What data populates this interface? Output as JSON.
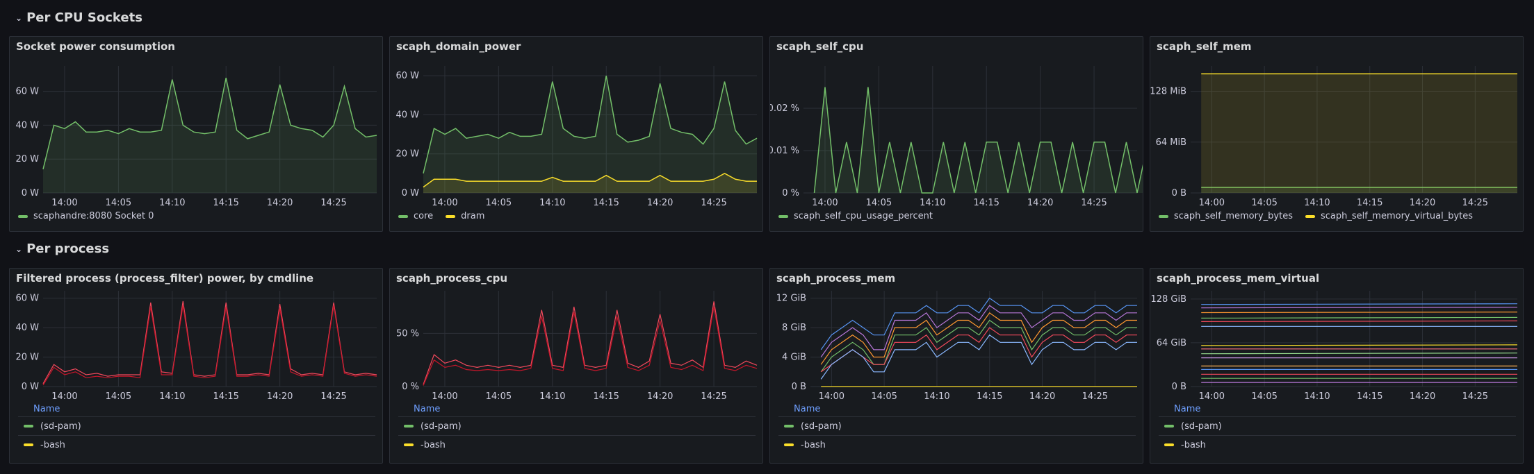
{
  "rows": [
    {
      "title": "Per CPU Sockets"
    },
    {
      "title": "Per process"
    }
  ],
  "colors": {
    "green": "#73bf69",
    "yellow": "#fade2a",
    "red": "#f2495c",
    "bg": "#181b1f",
    "grid": "#2c3038"
  },
  "time_labels": [
    "14:00",
    "14:05",
    "14:10",
    "14:15",
    "14:20",
    "14:25"
  ],
  "panels": [
    {
      "title": "Socket power consumption",
      "legend": [
        {
          "label": "scaphandre:8080 Socket 0",
          "color": "#73bf69"
        }
      ]
    },
    {
      "title": "scaph_domain_power",
      "legend": [
        {
          "label": "core",
          "color": "#73bf69"
        },
        {
          "label": "dram",
          "color": "#fade2a"
        }
      ]
    },
    {
      "title": "scaph_self_cpu",
      "legend": [
        {
          "label": "scaph_self_cpu_usage_percent",
          "color": "#73bf69"
        }
      ]
    },
    {
      "title": "scaph_self_mem",
      "legend": [
        {
          "label": "scaph_self_memory_bytes",
          "color": "#73bf69"
        },
        {
          "label": "scaph_self_memory_virtual_bytes",
          "color": "#fade2a"
        }
      ]
    },
    {
      "title": "Filtered process (process_filter) power, by cmdline",
      "table_header": "Name",
      "legend": [
        {
          "label": "(sd-pam)",
          "color": "#73bf69"
        },
        {
          "label": "-bash",
          "color": "#fade2a"
        }
      ]
    },
    {
      "title": "scaph_process_cpu",
      "table_header": "Name",
      "legend": [
        {
          "label": "(sd-pam)",
          "color": "#73bf69"
        },
        {
          "label": "-bash",
          "color": "#fade2a"
        }
      ]
    },
    {
      "title": "scaph_process_mem",
      "table_header": "Name",
      "legend": [
        {
          "label": "(sd-pam)",
          "color": "#73bf69"
        },
        {
          "label": "-bash",
          "color": "#fade2a"
        }
      ]
    },
    {
      "title": "scaph_process_mem_virtual",
      "table_header": "Name",
      "legend": [
        {
          "label": "(sd-pam)",
          "color": "#73bf69"
        },
        {
          "label": "-bash",
          "color": "#fade2a"
        }
      ]
    }
  ],
  "chart_data": [
    {
      "type": "area",
      "panel": 0,
      "y_ticks": [
        "0 W",
        "20 W",
        "40 W",
        "60 W"
      ],
      "ylim": [
        0,
        75
      ],
      "x": [
        "13:58",
        "13:59",
        "14:00",
        "14:01",
        "14:02",
        "14:03",
        "14:04",
        "14:05",
        "14:06",
        "14:07",
        "14:08",
        "14:09",
        "14:10",
        "14:11",
        "14:12",
        "14:13",
        "14:14",
        "14:15",
        "14:16",
        "14:17",
        "14:18",
        "14:19",
        "14:20",
        "14:21",
        "14:22",
        "14:23",
        "14:24",
        "14:25",
        "14:26",
        "14:27",
        "14:28",
        "14:29"
      ],
      "series": [
        {
          "name": "scaphandre:8080 Socket 0",
          "color": "#73bf69",
          "values": [
            14,
            40,
            38,
            42,
            36,
            36,
            37,
            35,
            38,
            36,
            36,
            37,
            67,
            40,
            36,
            35,
            36,
            68,
            37,
            32,
            34,
            36,
            64,
            40,
            38,
            37,
            33,
            40,
            63,
            38,
            33,
            34
          ]
        }
      ]
    },
    {
      "type": "area",
      "panel": 1,
      "y_ticks": [
        "0 W",
        "20 W",
        "40 W",
        "60 W"
      ],
      "ylim": [
        0,
        65
      ],
      "x": [
        "13:58",
        "13:59",
        "14:00",
        "14:01",
        "14:02",
        "14:03",
        "14:04",
        "14:05",
        "14:06",
        "14:07",
        "14:08",
        "14:09",
        "14:10",
        "14:11",
        "14:12",
        "14:13",
        "14:14",
        "14:15",
        "14:16",
        "14:17",
        "14:18",
        "14:19",
        "14:20",
        "14:21",
        "14:22",
        "14:23",
        "14:24",
        "14:25",
        "14:26",
        "14:27",
        "14:28",
        "14:29"
      ],
      "series": [
        {
          "name": "core",
          "color": "#73bf69",
          "values": [
            10,
            33,
            30,
            33,
            28,
            29,
            30,
            28,
            31,
            29,
            29,
            30,
            57,
            33,
            29,
            28,
            29,
            60,
            30,
            26,
            27,
            29,
            56,
            33,
            31,
            30,
            25,
            33,
            57,
            32,
            25,
            28
          ]
        },
        {
          "name": "dram",
          "color": "#fade2a",
          "values": [
            3,
            7,
            7,
            7,
            6,
            6,
            6,
            6,
            6,
            6,
            6,
            6,
            8,
            6,
            6,
            6,
            6,
            9,
            6,
            6,
            6,
            6,
            9,
            6,
            6,
            6,
            6,
            7,
            10,
            7,
            6,
            6
          ]
        }
      ]
    },
    {
      "type": "area",
      "panel": 2,
      "y_ticks": [
        "0 %",
        "0.01 %",
        "0.02 %"
      ],
      "ylim": [
        0,
        0.03
      ],
      "x": [
        "13:59",
        "14:00",
        "14:01",
        "14:02",
        "14:03",
        "14:04",
        "14:05",
        "14:06",
        "14:07",
        "14:08",
        "14:09",
        "14:10",
        "14:11",
        "14:12",
        "14:13",
        "14:14",
        "14:15",
        "14:16",
        "14:17",
        "14:18",
        "14:19",
        "14:20",
        "14:21",
        "14:22",
        "14:23",
        "14:24",
        "14:25",
        "14:26",
        "14:27",
        "14:28",
        "14:29",
        "14:30"
      ],
      "series": [
        {
          "name": "scaph_self_cpu_usage_percent",
          "color": "#73bf69",
          "values": [
            0,
            0.025,
            0,
            0.012,
            0,
            0.025,
            0,
            0.012,
            0,
            0.012,
            0,
            0,
            0.012,
            0,
            0.012,
            0,
            0.012,
            0.012,
            0,
            0.012,
            0,
            0.012,
            0.012,
            0,
            0.012,
            0,
            0.012,
            0.012,
            0,
            0.012,
            0,
            0.012
          ]
        }
      ]
    },
    {
      "type": "area",
      "panel": 3,
      "y_ticks": [
        "0 B",
        "64 MiB",
        "128 MiB"
      ],
      "ylim": [
        0,
        160
      ],
      "x": [
        "13:59",
        "14:29"
      ],
      "series": [
        {
          "name": "scaph_self_memory_bytes",
          "color": "#73bf69",
          "values": [
            7,
            7
          ]
        },
        {
          "name": "scaph_self_memory_virtual_bytes",
          "color": "#fade2a",
          "values": [
            150,
            150
          ]
        }
      ]
    },
    {
      "type": "line",
      "panel": 4,
      "y_ticks": [
        "0 W",
        "20 W",
        "40 W",
        "60 W"
      ],
      "ylim": [
        0,
        65
      ],
      "x": [
        "13:58",
        "13:59",
        "14:00",
        "14:01",
        "14:02",
        "14:03",
        "14:04",
        "14:05",
        "14:06",
        "14:07",
        "14:08",
        "14:09",
        "14:10",
        "14:11",
        "14:12",
        "14:13",
        "14:14",
        "14:15",
        "14:16",
        "14:17",
        "14:18",
        "14:19",
        "14:20",
        "14:21",
        "14:22",
        "14:23",
        "14:24",
        "14:25",
        "14:26",
        "14:27",
        "14:28",
        "14:29"
      ],
      "series": [
        {
          "color": "#f2495c",
          "values": [
            2,
            15,
            10,
            12,
            8,
            9,
            7,
            8,
            8,
            8,
            57,
            10,
            9,
            58,
            8,
            7,
            8,
            57,
            8,
            8,
            9,
            8,
            56,
            12,
            8,
            9,
            8,
            57,
            10,
            8,
            9,
            8
          ]
        },
        {
          "color": "#c4162a",
          "values": [
            1,
            13,
            8,
            10,
            6,
            7,
            6,
            7,
            7,
            6,
            54,
            8,
            8,
            55,
            7,
            6,
            7,
            54,
            7,
            7,
            8,
            7,
            53,
            10,
            7,
            8,
            7,
            55,
            9,
            7,
            8,
            7
          ]
        }
      ]
    },
    {
      "type": "line",
      "panel": 5,
      "y_ticks": [
        "0 %",
        "50 %"
      ],
      "ylim": [
        0,
        90
      ],
      "x": [
        "13:58",
        "13:59",
        "14:00",
        "14:01",
        "14:02",
        "14:03",
        "14:04",
        "14:05",
        "14:06",
        "14:07",
        "14:08",
        "14:09",
        "14:10",
        "14:11",
        "14:12",
        "14:13",
        "14:14",
        "14:15",
        "14:16",
        "14:17",
        "14:18",
        "14:19",
        "14:20",
        "14:21",
        "14:22",
        "14:23",
        "14:24",
        "14:25",
        "14:26",
        "14:27",
        "14:28",
        "14:29"
      ],
      "series": [
        {
          "color": "#f2495c",
          "values": [
            2,
            30,
            22,
            25,
            20,
            18,
            20,
            18,
            20,
            18,
            20,
            72,
            20,
            18,
            75,
            20,
            18,
            20,
            72,
            22,
            18,
            24,
            68,
            22,
            20,
            25,
            18,
            80,
            20,
            18,
            24,
            20
          ]
        },
        {
          "color": "#c4162a",
          "values": [
            1,
            25,
            18,
            20,
            16,
            15,
            16,
            15,
            16,
            15,
            17,
            66,
            17,
            15,
            70,
            17,
            15,
            17,
            66,
            18,
            15,
            20,
            62,
            18,
            16,
            20,
            15,
            75,
            17,
            15,
            20,
            17
          ]
        }
      ]
    },
    {
      "type": "line",
      "panel": 6,
      "y_ticks": [
        "0 B",
        "4 GiB",
        "8 GiB",
        "12 GiB"
      ],
      "ylim": [
        0,
        13
      ],
      "x": [
        "13:59",
        "14:00",
        "14:01",
        "14:02",
        "14:03",
        "14:04",
        "14:05",
        "14:06",
        "14:07",
        "14:08",
        "14:09",
        "14:10",
        "14:11",
        "14:12",
        "14:13",
        "14:14",
        "14:15",
        "14:16",
        "14:17",
        "14:18",
        "14:19",
        "14:20",
        "14:21",
        "14:22",
        "14:23",
        "14:24",
        "14:25",
        "14:26",
        "14:27",
        "14:28",
        "14:29"
      ],
      "series": [
        {
          "color": "#5794f2",
          "values": [
            5,
            7,
            8,
            9,
            8,
            7,
            7,
            10,
            10,
            10,
            11,
            10,
            10,
            11,
            11,
            10,
            12,
            11,
            11,
            11,
            10,
            10,
            11,
            11,
            10,
            10,
            11,
            11,
            10,
            11,
            11
          ]
        },
        {
          "color": "#b877d9",
          "values": [
            4,
            6,
            7,
            8,
            7,
            5,
            5,
            9,
            9,
            9,
            10,
            8,
            9,
            10,
            10,
            9,
            11,
            10,
            10,
            10,
            8,
            9,
            10,
            10,
            9,
            9,
            10,
            10,
            9,
            10,
            10
          ]
        },
        {
          "color": "#ff9830",
          "values": [
            3,
            5,
            6,
            7,
            6,
            4,
            4,
            8,
            8,
            8,
            9,
            7,
            8,
            9,
            9,
            8,
            10,
            9,
            9,
            9,
            6,
            8,
            9,
            9,
            8,
            8,
            9,
            9,
            8,
            9,
            9
          ]
        },
        {
          "color": "#73bf69",
          "values": [
            2,
            4,
            5,
            6,
            5,
            3,
            3,
            7,
            7,
            7,
            8,
            6,
            7,
            8,
            8,
            7,
            9,
            8,
            8,
            8,
            5,
            7,
            8,
            8,
            7,
            7,
            8,
            8,
            7,
            8,
            8
          ]
        },
        {
          "color": "#f2495c",
          "values": [
            2,
            3,
            4,
            5,
            4,
            3,
            3,
            6,
            6,
            6,
            7,
            5,
            6,
            7,
            7,
            6,
            8,
            7,
            7,
            7,
            4,
            6,
            7,
            7,
            6,
            6,
            7,
            7,
            6,
            7,
            7
          ]
        },
        {
          "color": "#8ab8ff",
          "values": [
            1,
            3,
            4,
            5,
            4,
            2,
            2,
            5,
            5,
            5,
            6,
            4,
            5,
            6,
            6,
            5,
            7,
            6,
            6,
            6,
            3,
            5,
            6,
            6,
            5,
            5,
            6,
            6,
            5,
            6,
            6
          ]
        },
        {
          "color": "#fade2a",
          "values": [
            0,
            0,
            0,
            0,
            0,
            0,
            0,
            0,
            0,
            0,
            0,
            0,
            0,
            0,
            0,
            0,
            0,
            0,
            0,
            0,
            0,
            0,
            0,
            0,
            0,
            0,
            0,
            0,
            0,
            0,
            0
          ]
        }
      ]
    },
    {
      "type": "line",
      "panel": 7,
      "y_ticks": [
        "0 B",
        "64 GiB",
        "128 GiB"
      ],
      "ylim": [
        0,
        140
      ],
      "x": [
        "13:59",
        "14:29"
      ],
      "series": [
        {
          "color": "#5794f2",
          "values": [
            120,
            121
          ]
        },
        {
          "color": "#b877d9",
          "values": [
            115,
            116
          ]
        },
        {
          "color": "#ff9830",
          "values": [
            108,
            109
          ]
        },
        {
          "color": "#73bf69",
          "values": [
            100,
            101
          ]
        },
        {
          "color": "#f2495c",
          "values": [
            95,
            96
          ]
        },
        {
          "color": "#8ab8ff",
          "values": [
            88,
            88
          ]
        },
        {
          "color": "#fade2a",
          "values": [
            60,
            61
          ]
        },
        {
          "color": "#ff7383",
          "values": [
            55,
            55
          ]
        },
        {
          "color": "#96d98d",
          "values": [
            48,
            49
          ]
        },
        {
          "color": "#ca95e5",
          "values": [
            42,
            42
          ]
        },
        {
          "color": "#ffb357",
          "values": [
            30,
            30
          ]
        },
        {
          "color": "#5794f2",
          "values": [
            25,
            25
          ]
        },
        {
          "color": "#f2495c",
          "values": [
            18,
            18
          ]
        },
        {
          "color": "#73bf69",
          "values": [
            12,
            12
          ]
        },
        {
          "color": "#b877d9",
          "values": [
            6,
            6
          ]
        }
      ]
    }
  ]
}
